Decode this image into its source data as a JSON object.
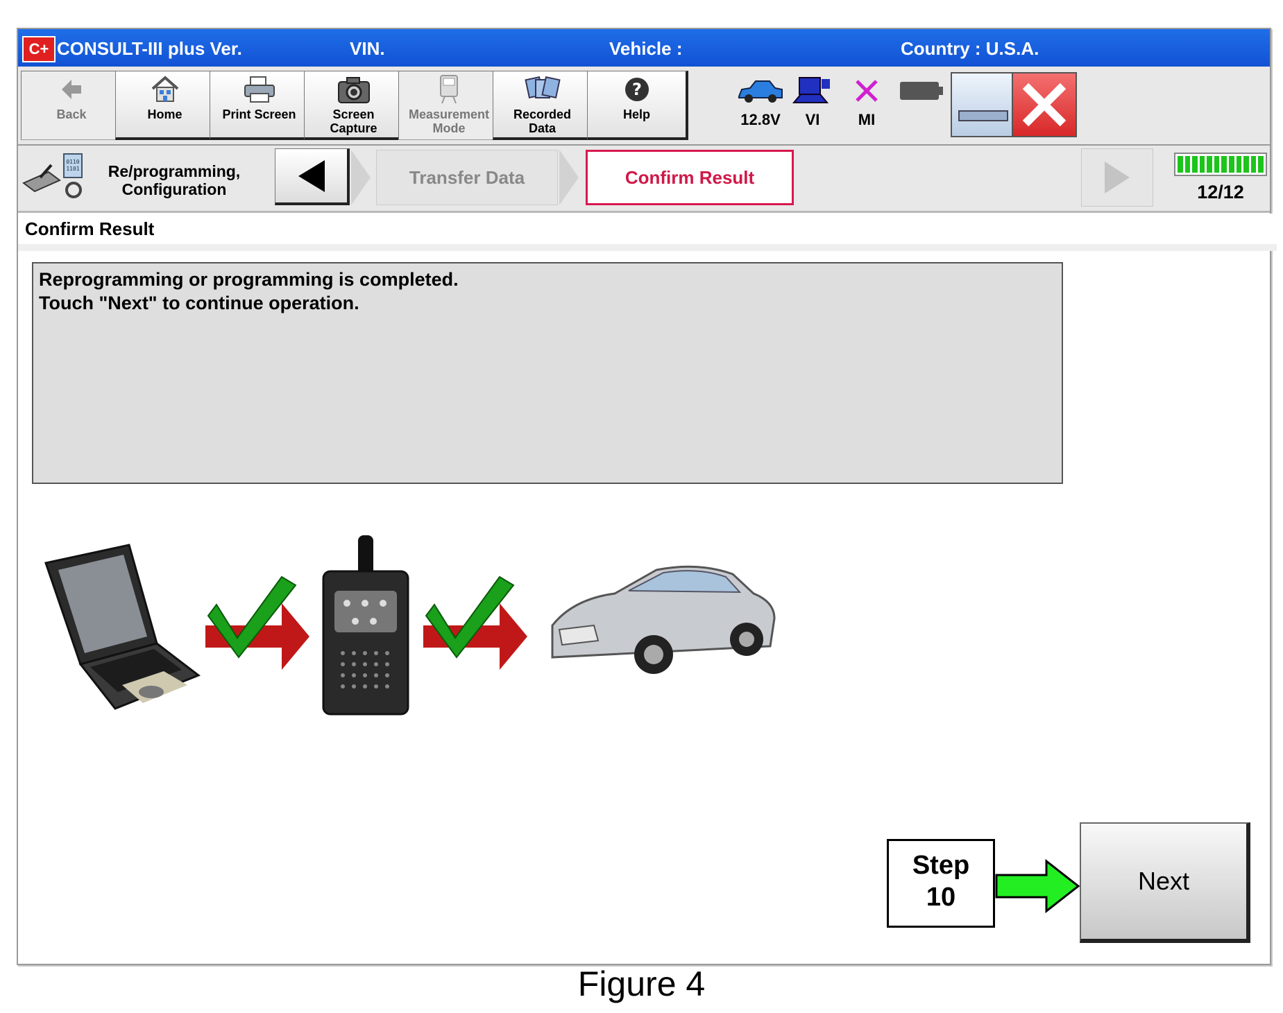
{
  "titlebar": {
    "logo_text": "C+",
    "app_name": "CONSULT-III plus  Ver.",
    "vin_label": "VIN.",
    "vehicle_label": "Vehicle :",
    "country": "Country : U.S.A."
  },
  "toolbar": {
    "back": "Back",
    "home": "Home",
    "print_screen": "Print Screen",
    "screen_capture_1": "Screen",
    "screen_capture_2": "Capture",
    "measurement_1": "Measurement",
    "measurement_2": "Mode",
    "recorded_1": "Recorded",
    "recorded_2": "Data",
    "help": "Help"
  },
  "status": {
    "voltage": "12.8V",
    "vi": "VI",
    "mi": "MI"
  },
  "breadcrumb": {
    "section_1": "Re/programming,",
    "section_2": "Configuration",
    "prev_step": "Transfer Data",
    "current_step": "Confirm Result",
    "progress_total": 12,
    "progress_done": 12,
    "page_count": "12/12"
  },
  "content": {
    "title": "Confirm Result",
    "message_line_1": "Reprogramming  or  programming  is  completed.",
    "message_line_2": "Touch \"Next\" to continue operation."
  },
  "annotation": {
    "step_word": "Step",
    "step_number": "10"
  },
  "next_label": "Next",
  "caption": "Figure 4",
  "colors": {
    "titlebar_blue": "#1a60e0",
    "active_step_border": "#d81850",
    "active_step_text": "#d01848",
    "progress_green": "#1cc41c",
    "close_red": "#e03a3a",
    "arrow_green": "#22ee22",
    "check_green": "#1aa01a",
    "arrow_red": "#c01818"
  }
}
